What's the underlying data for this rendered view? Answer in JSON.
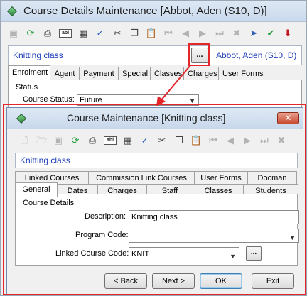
{
  "outer_window": {
    "title": "Course Details Maintenance  [Abbot, Aden (S10, D)]",
    "course_link": "Knitting class",
    "ellipsis_label": "...",
    "student_link": "Abbot, Aden (S10, D)",
    "toolbar_icons": [
      "save-icon",
      "refresh-icon",
      "print-icon",
      "abl-icon",
      "calculator-icon",
      "spellcheck-icon",
      "cut-icon",
      "copy-icon",
      "paste-icon",
      "first-record-icon",
      "previous-record-icon",
      "next-record-icon",
      "last-record-icon",
      "delete-icon",
      "pin-icon",
      "approve-icon",
      "download-icon"
    ],
    "toolbar_glyphs": [
      "▣",
      "⟳",
      "⎙",
      "abl",
      "▦",
      "✓",
      "✂",
      "❐",
      "📋",
      "⏮",
      "◀",
      "▶",
      "⏭",
      "✖",
      "➤",
      "✔",
      "⬇"
    ],
    "tabs": [
      "Enrolment",
      "Agent",
      "Payment",
      "Special",
      "Classes",
      "Charges",
      "User Forms"
    ],
    "active_tab": "Enrolment",
    "status_group_label": "Status",
    "course_status_label": "Course Status:",
    "course_status_value": "Future"
  },
  "dialog": {
    "title": "Course Maintenance  [Knitting class]",
    "close_label": "✕",
    "toolbar_glyphs": [
      "🗋",
      "🗁",
      "▣",
      "⟳",
      "⎙",
      "abl",
      "▦",
      "✓",
      "✂",
      "❐",
      "📋",
      "⏮",
      "◀",
      "▶",
      "⏭",
      "✖"
    ],
    "course_link": "Knitting class",
    "tabs_back_row": [
      "Linked Courses",
      "Commission Link Courses",
      "User Forms",
      "Docman"
    ],
    "tabs_front_row": [
      "General",
      "Dates",
      "Charges",
      "Staff",
      "Classes",
      "Students"
    ],
    "active_tab": "General",
    "group_label": "Course Details",
    "description_label": "Description:",
    "description_value": "Knitting class",
    "program_code_label": "Program Code:",
    "program_code_value": "",
    "linked_course_code_label": "Linked Course Code:",
    "linked_course_code_value": "KNIT",
    "linked_ellipsis": "...",
    "buttons": {
      "back": "< Back",
      "next": "Next >",
      "ok": "OK",
      "exit": "Exit"
    }
  },
  "colors": {
    "annotation": "#e3262a",
    "link": "#1d3cb8"
  }
}
